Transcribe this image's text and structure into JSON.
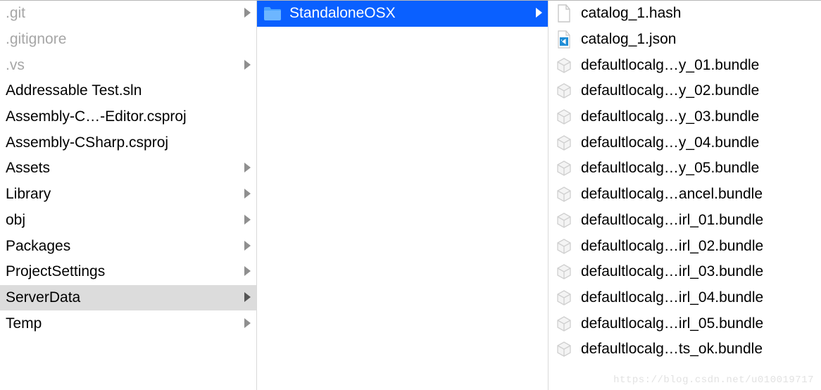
{
  "column1": {
    "items": [
      {
        "label": ".git",
        "dim": true,
        "folder": true
      },
      {
        "label": ".gitignore",
        "dim": true,
        "folder": false
      },
      {
        "label": ".vs",
        "dim": true,
        "folder": true
      },
      {
        "label": "Addressable Test.sln",
        "dim": false,
        "folder": false
      },
      {
        "label": "Assembly-C…-Editor.csproj",
        "dim": false,
        "folder": false
      },
      {
        "label": "Assembly-CSharp.csproj",
        "dim": false,
        "folder": false
      },
      {
        "label": "Assets",
        "dim": false,
        "folder": true
      },
      {
        "label": "Library",
        "dim": false,
        "folder": true
      },
      {
        "label": "obj",
        "dim": false,
        "folder": true
      },
      {
        "label": "Packages",
        "dim": false,
        "folder": true
      },
      {
        "label": "ProjectSettings",
        "dim": false,
        "folder": true
      },
      {
        "label": "ServerData",
        "dim": false,
        "folder": true,
        "active": true
      },
      {
        "label": "Temp",
        "dim": false,
        "folder": true
      }
    ]
  },
  "column2": {
    "items": [
      {
        "label": "StandaloneOSX",
        "folder": true,
        "selected": true
      }
    ]
  },
  "column3": {
    "items": [
      {
        "label": "catalog_1.hash",
        "icon": "file-blank"
      },
      {
        "label": "catalog_1.json",
        "icon": "file-vscode"
      },
      {
        "label": "defaultlocalg…y_01.bundle",
        "icon": "bundle"
      },
      {
        "label": "defaultlocalg…y_02.bundle",
        "icon": "bundle"
      },
      {
        "label": "defaultlocalg…y_03.bundle",
        "icon": "bundle"
      },
      {
        "label": "defaultlocalg…y_04.bundle",
        "icon": "bundle"
      },
      {
        "label": "defaultlocalg…y_05.bundle",
        "icon": "bundle"
      },
      {
        "label": "defaultlocalg…ancel.bundle",
        "icon": "bundle"
      },
      {
        "label": "defaultlocalg…irl_01.bundle",
        "icon": "bundle"
      },
      {
        "label": "defaultlocalg…irl_02.bundle",
        "icon": "bundle"
      },
      {
        "label": "defaultlocalg…irl_03.bundle",
        "icon": "bundle"
      },
      {
        "label": "defaultlocalg…irl_04.bundle",
        "icon": "bundle"
      },
      {
        "label": "defaultlocalg…irl_05.bundle",
        "icon": "bundle"
      },
      {
        "label": "defaultlocalg…ts_ok.bundle",
        "icon": "bundle"
      }
    ]
  },
  "watermark": "https://blog.csdn.net/u010019717"
}
